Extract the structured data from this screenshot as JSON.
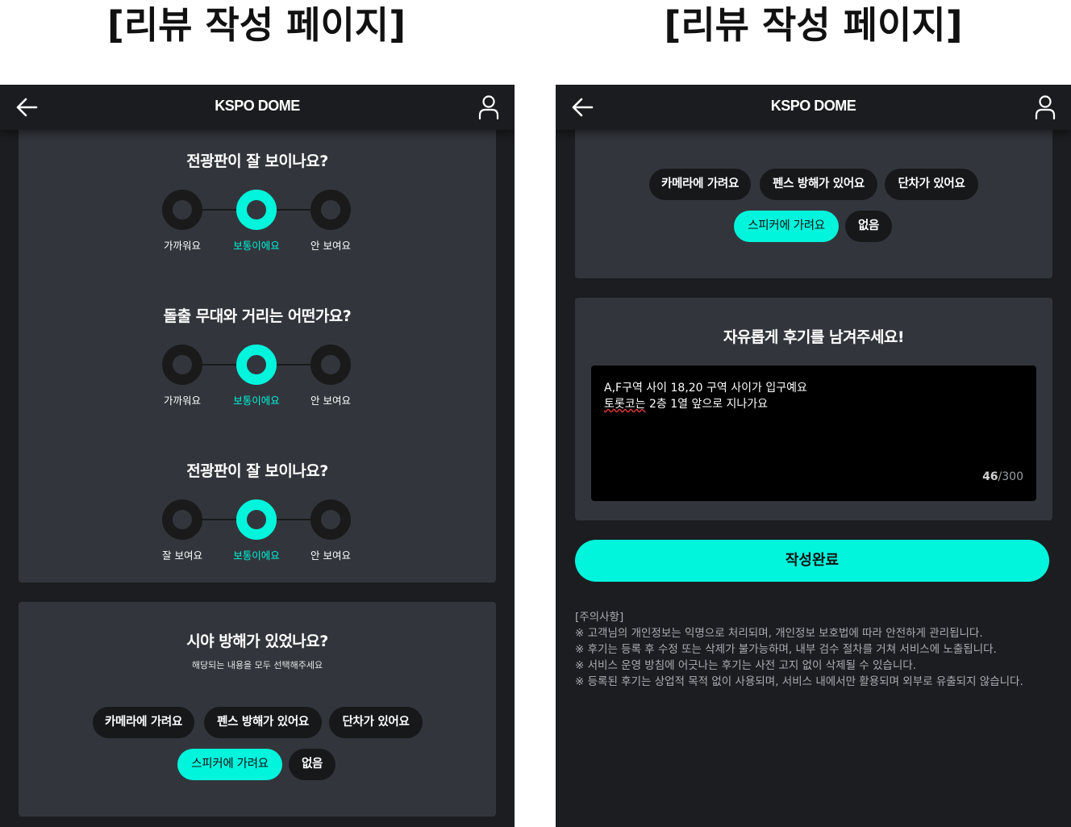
{
  "headings": {
    "left": "[리뷰 작성 페이지]",
    "right": "[리뷰 작성 페이지]"
  },
  "topbar": {
    "title": "KSPO DOME",
    "back_icon": "arrow-left-icon",
    "user_icon": "user-icon"
  },
  "colors": {
    "accent": "#00f5dc",
    "background": "#1c1d20",
    "card": "#32363c",
    "chip": "#17181a"
  },
  "questions": [
    {
      "title": "전광판이 잘 보이나요?",
      "options": [
        "가까워요",
        "보통이에요",
        "안 보여요"
      ],
      "selected_index": 1
    },
    {
      "title": "돌출 무대와 거리는 어떤가요?",
      "options": [
        "가까워요",
        "보통이에요",
        "안 보여요"
      ],
      "selected_index": 1
    },
    {
      "title": "전광판이 잘 보이나요?",
      "options": [
        "잘 보여요",
        "보통이에요",
        "안 보여요"
      ],
      "selected_index": 1
    }
  ],
  "obstruction": {
    "title": "시야 방해가 있었나요?",
    "subtitle": "해당되는 내용을 모두 선택해주세요",
    "chips": [
      "카메라에 가려요",
      "펜스 방해가 있어요",
      "단차가 있어요",
      "스피커에 가려요",
      "없음"
    ],
    "selected": [
      "스피커에 가려요"
    ]
  },
  "review": {
    "title": "자유롭게 후기를 남겨주세요!",
    "text_line1": "A,F구역 사이 18,20 구역 사이가 입구예요",
    "text_line2_misspelled": "토롯코는",
    "text_line2_rest": " 2층 1열 앞으로 지나가요",
    "count": "46",
    "max": "/300"
  },
  "submit_label": "작성완료",
  "notice": {
    "title": "[주의사항]",
    "items": [
      "※ 고객님의 개인정보는 익명으로 처리되며, 개인정보 보호법에 따라 안전하게 관리됩니다.",
      "※ 후기는 등록 후 수정 또는 삭제가 불가능하며, 내부 검수 절차를 거쳐 서비스에 노출됩니다.",
      "※ 서비스 운영 방침에 어긋나는 후기는 사전 고지 없이 삭제될 수 있습니다.",
      "※ 등록된 후기는 상업적 목적 없이 사용되며, 서비스 내에서만 활용되며 외부로 유출되지 않습니다."
    ]
  }
}
